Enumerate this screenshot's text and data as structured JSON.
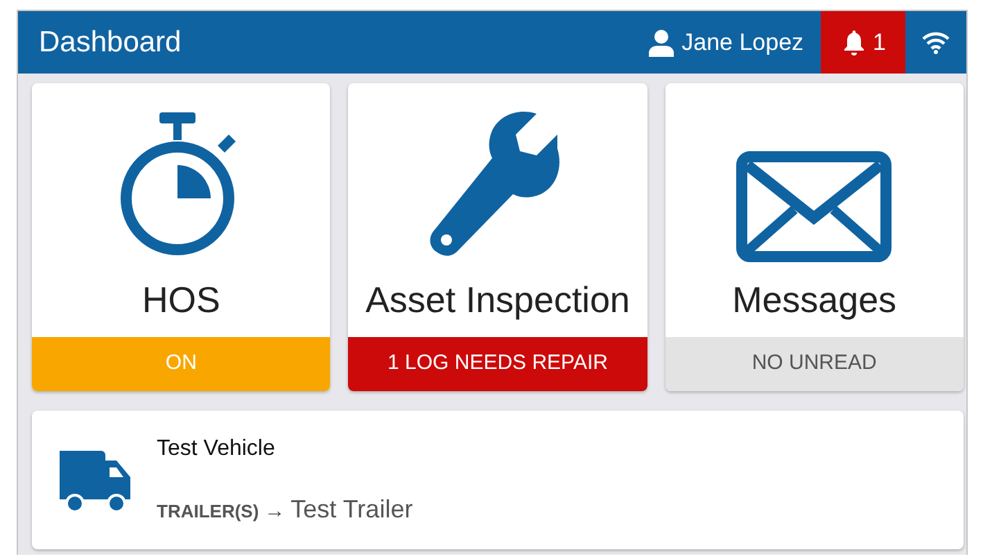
{
  "header": {
    "title": "Dashboard",
    "user": "Jane Lopez",
    "alerts": "1"
  },
  "tiles": [
    {
      "label": "HOS",
      "status": {
        "text": "ON",
        "kind": "warning"
      }
    },
    {
      "label": "Asset Inspection",
      "status": {
        "text": "1 LOG NEEDS REPAIR",
        "kind": "alert"
      }
    },
    {
      "label": "Messages",
      "status": {
        "text": "NO UNREAD",
        "kind": "neutral"
      }
    }
  ],
  "vehicle": {
    "name": "Test Vehicle",
    "trailer_label": "TRAILER(S)",
    "arrow": "→",
    "trailer": "Test Trailer"
  }
}
